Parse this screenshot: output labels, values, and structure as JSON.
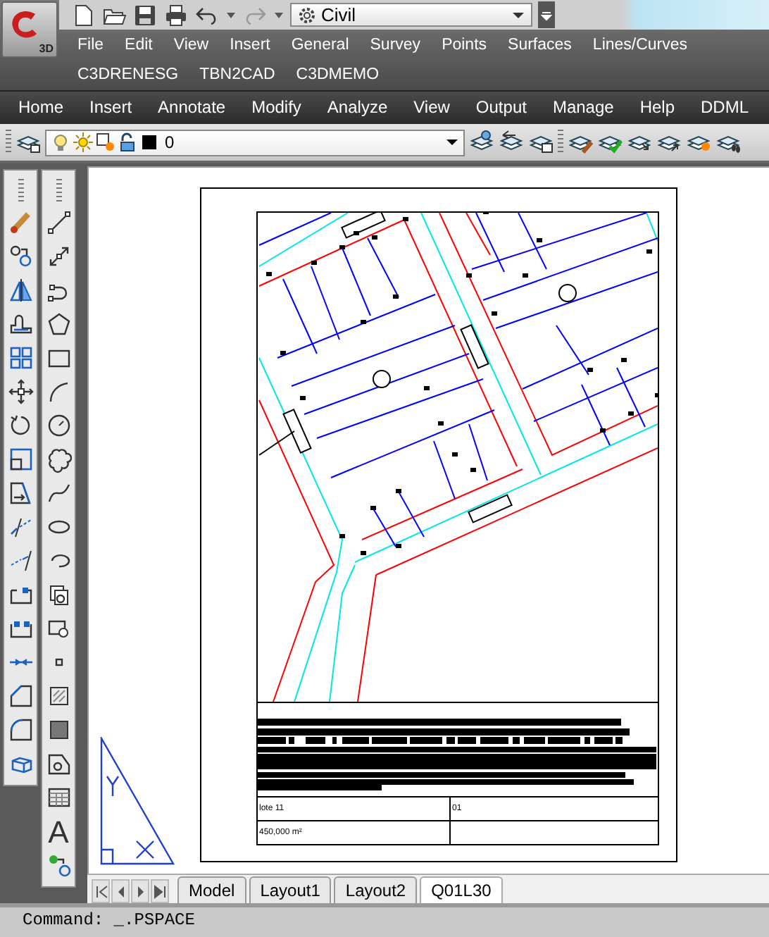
{
  "app_button": {
    "badge": "3D"
  },
  "quick_access": {
    "workspace": "Civil"
  },
  "menu_rows": [
    [
      "File",
      "Edit",
      "View",
      "Insert",
      "General",
      "Survey",
      "Points",
      "Surfaces",
      "Lines/Curves"
    ],
    [
      "C3DRENESG",
      "TBN2CAD",
      "C3DMEMO"
    ]
  ],
  "ribbon_tabs": [
    {
      "label": "Home",
      "selected": false
    },
    {
      "label": "Insert",
      "selected": false
    },
    {
      "label": "Annotate",
      "selected": false
    },
    {
      "label": "Modify",
      "selected": false
    },
    {
      "label": "Analyze",
      "selected": false
    },
    {
      "label": "View",
      "selected": false
    },
    {
      "label": "Output",
      "selected": false
    },
    {
      "label": "Manage",
      "selected": false
    },
    {
      "label": "Help",
      "selected": false
    },
    {
      "label": "DDML",
      "selected": false
    }
  ],
  "layer_control": {
    "value": "0"
  },
  "draw_toolbar": {
    "text_tool_glyph": "A"
  },
  "title_block": {
    "rows": [
      [
        "lote 11",
        "01"
      ],
      [
        "450,000 m²"
      ]
    ]
  },
  "layout_tabs": [
    {
      "label": "Model",
      "selected": false
    },
    {
      "label": "Layout1",
      "selected": false
    },
    {
      "label": "Layout2",
      "selected": false
    },
    {
      "label": "Q01L30",
      "selected": true
    }
  ],
  "command_line": [
    "Command: _.PSPACE"
  ]
}
